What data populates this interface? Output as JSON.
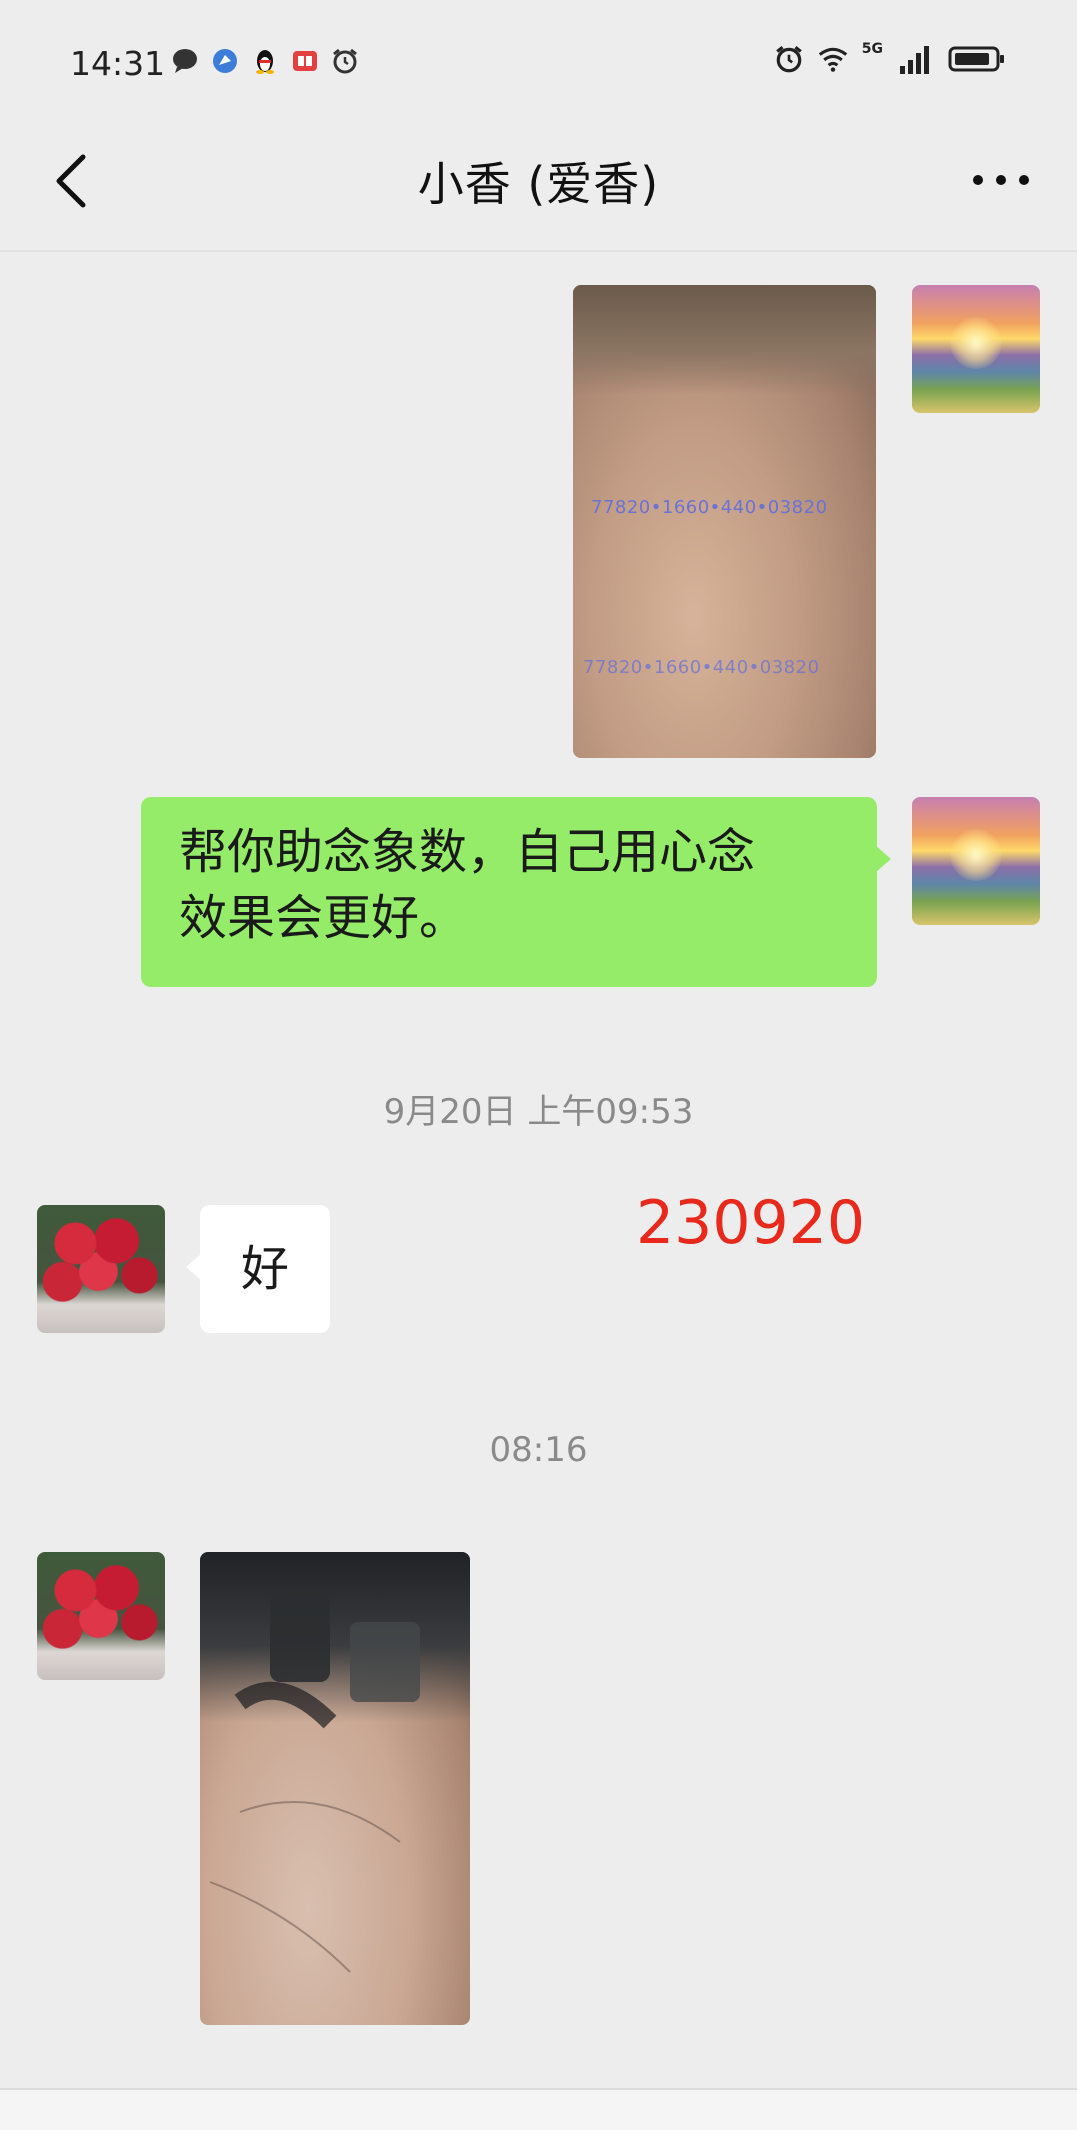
{
  "status_bar": {
    "time": "14:31",
    "network": "5G",
    "left_icons": [
      "chat-bubble-icon",
      "browser-icon",
      "qq-penguin-icon",
      "book-icon",
      "alarm-icon"
    ],
    "right_icons": [
      "alarm-icon",
      "wifi-icon",
      "signal-icon",
      "battery-icon"
    ]
  },
  "header": {
    "title": "小香 (爱香)"
  },
  "messages": [
    {
      "type": "image",
      "sender": "self",
      "overlay_text": [
        "77820•1660•440•03820",
        "77820•1660•440•03820"
      ]
    },
    {
      "type": "text",
      "sender": "self",
      "lines": [
        "帮你助念象数，自己用心念",
        "效果会更好。"
      ]
    },
    {
      "type": "timestamp",
      "text": "9月20日 上午09:53"
    },
    {
      "type": "text",
      "sender": "peer",
      "text": "好"
    },
    {
      "type": "annotation",
      "text": "230920",
      "color": "#e8291c"
    },
    {
      "type": "timestamp",
      "text": "08:16"
    },
    {
      "type": "image",
      "sender": "peer"
    }
  ],
  "colors": {
    "background": "#ededed",
    "self_bubble": "#95ec69",
    "peer_bubble": "#ffffff",
    "annotation": "#e8291c"
  }
}
